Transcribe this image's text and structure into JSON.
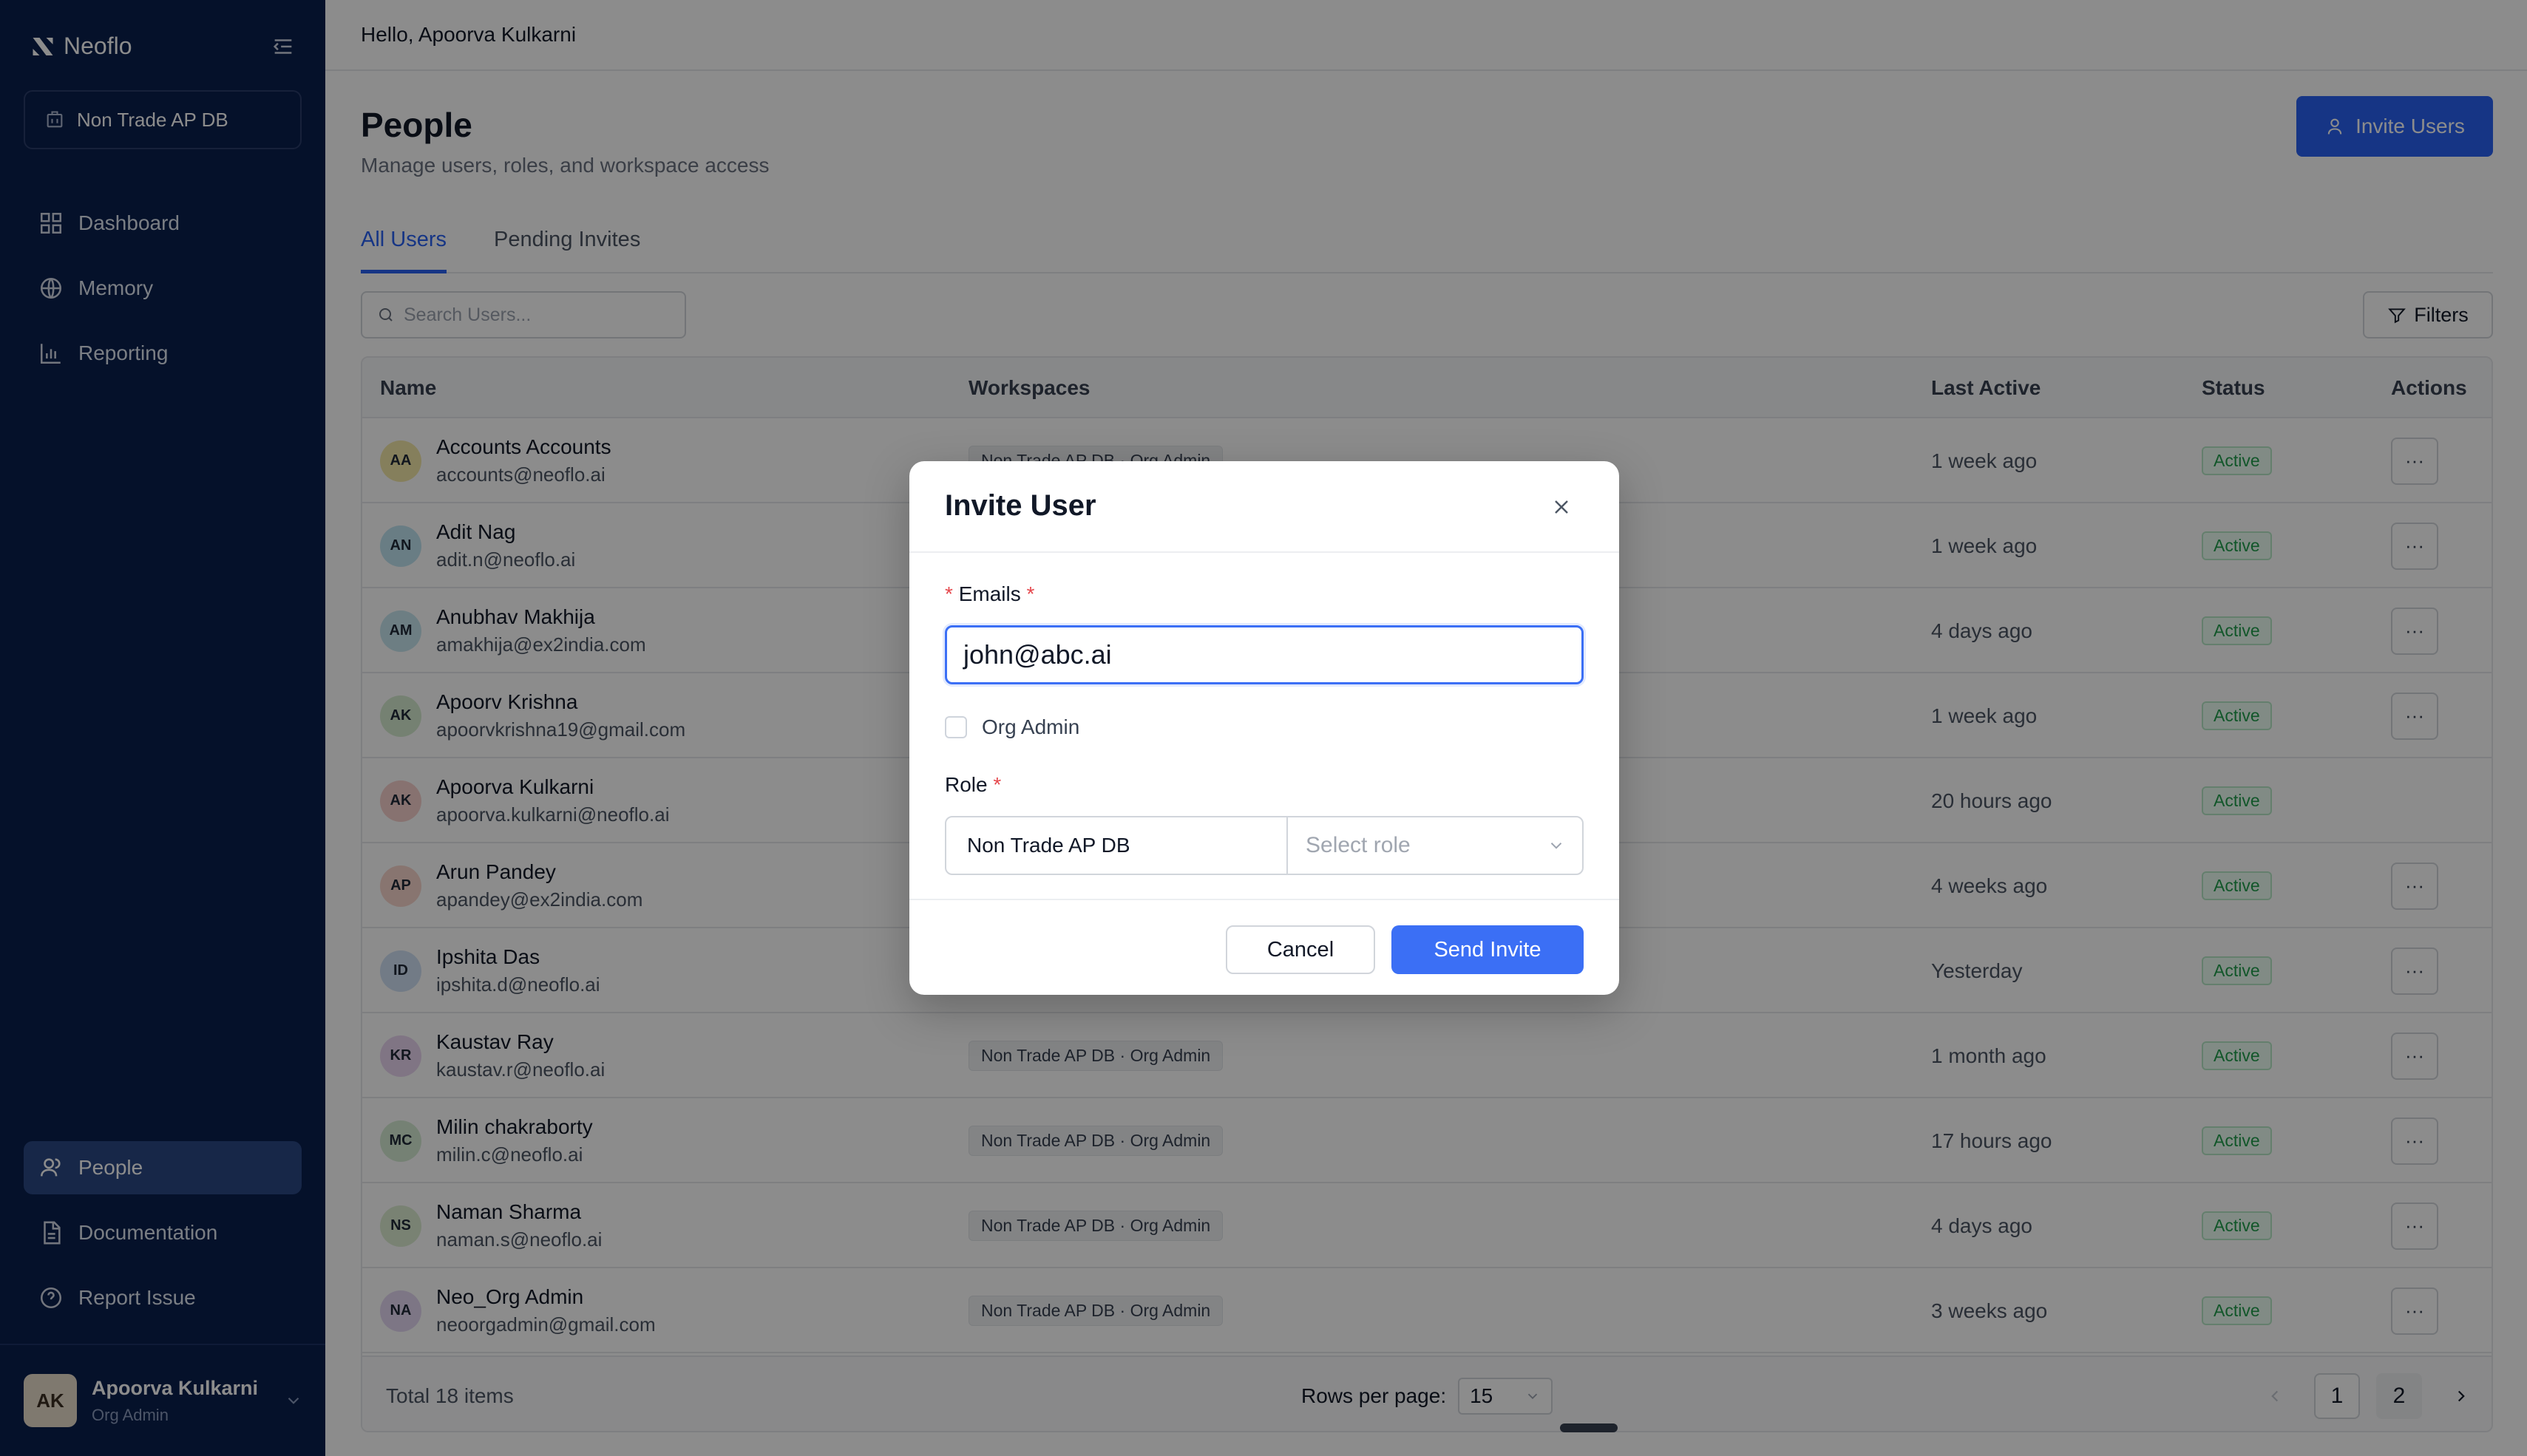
{
  "app": {
    "brand": "Neoflo",
    "greeting": "Hello, Apoorva Kulkarni"
  },
  "sidebar": {
    "workspace": "Non Trade AP DB",
    "top_items": [
      {
        "label": "Dashboard",
        "icon": "dashboard-icon"
      },
      {
        "label": "Memory",
        "icon": "globe-icon"
      },
      {
        "label": "Reporting",
        "icon": "bar-chart-icon"
      }
    ],
    "bottom_items": [
      {
        "label": "People",
        "icon": "users-icon",
        "active": true
      },
      {
        "label": "Documentation",
        "icon": "document-icon"
      },
      {
        "label": "Report Issue",
        "icon": "help-circle-icon"
      }
    ],
    "user": {
      "initials": "AK",
      "name": "Apoorva Kulkarni",
      "role": "Org Admin"
    }
  },
  "page": {
    "title": "People",
    "subtitle": "Manage users, roles, and workspace access",
    "invite_label": "Invite Users",
    "tabs": [
      {
        "label": "All Users",
        "active": true
      },
      {
        "label": "Pending Invites",
        "active": false
      }
    ],
    "search_placeholder": "Search Users...",
    "filters_label": "Filters"
  },
  "table": {
    "headers": [
      "Name",
      "Workspaces",
      "Last Active",
      "Status",
      "Actions"
    ],
    "rows": [
      {
        "initials": "AA",
        "avatar_color": "#f3e7a8",
        "name": "Accounts Accounts",
        "email": "accounts@neoflo.ai",
        "workspace": "Non Trade AP DB · Org Admin",
        "last_active": "1 week ago",
        "status": "Active",
        "has_action": true
      },
      {
        "initials": "AN",
        "avatar_color": "#bfe3f0",
        "name": "Adit Nag",
        "email": "adit.n@neoflo.ai",
        "workspace": "",
        "last_active": "1 week ago",
        "status": "Active",
        "has_action": true
      },
      {
        "initials": "AM",
        "avatar_color": "#c7e6ef",
        "name": "Anubhav Makhija",
        "email": "amakhija@ex2india.com",
        "workspace": "",
        "last_active": "4 days ago",
        "status": "Active",
        "has_action": true
      },
      {
        "initials": "AK",
        "avatar_color": "#d6ebcf",
        "name": "Apoorv Krishna",
        "email": "apoorvkrishna19@gmail.com",
        "workspace": "",
        "last_active": "1 week ago",
        "status": "Active",
        "has_action": true
      },
      {
        "initials": "AK",
        "avatar_color": "#f6cfcc",
        "name": "Apoorva Kulkarni",
        "email": "apoorva.kulkarni@neoflo.ai",
        "workspace": "",
        "last_active": "20 hours ago",
        "status": "Active",
        "has_action": false
      },
      {
        "initials": "AP",
        "avatar_color": "#f8d6cc",
        "name": "Arun Pandey",
        "email": "apandey@ex2india.com",
        "workspace": "",
        "last_active": "4 weeks ago",
        "status": "Active",
        "has_action": true
      },
      {
        "initials": "ID",
        "avatar_color": "#cfe0f5",
        "name": "Ipshita Das",
        "email": "ipshita.d@neoflo.ai",
        "workspace": "",
        "last_active": "Yesterday",
        "status": "Active",
        "has_action": true
      },
      {
        "initials": "KR",
        "avatar_color": "#ead6f1",
        "name": "Kaustav Ray",
        "email": "kaustav.r@neoflo.ai",
        "workspace": "Non Trade AP DB · Org Admin",
        "last_active": "1 month ago",
        "status": "Active",
        "has_action": true
      },
      {
        "initials": "MC",
        "avatar_color": "#d6ecd3",
        "name": "Milin chakraborty",
        "email": "milin.c@neoflo.ai",
        "workspace": "Non Trade AP DB · Org Admin",
        "last_active": "17 hours ago",
        "status": "Active",
        "has_action": true
      },
      {
        "initials": "NS",
        "avatar_color": "#dcedd2",
        "name": "Naman Sharma",
        "email": "naman.s@neoflo.ai",
        "workspace": "Non Trade AP DB · Org Admin",
        "last_active": "4 days ago",
        "status": "Active",
        "has_action": true
      },
      {
        "initials": "NA",
        "avatar_color": "#e3d8f3",
        "name": "Neo_Org Admin",
        "email": "neoorgadmin@gmail.com",
        "workspace": "Non Trade AP DB · Org Admin",
        "last_active": "3 weeks ago",
        "status": "Active",
        "has_action": true
      }
    ],
    "total": "Total 18 items",
    "rows_per_page_label": "Rows per page:",
    "rows_per_page": "15",
    "pages": [
      "1",
      "2"
    ],
    "current_page": "1"
  },
  "modal": {
    "title": "Invite User",
    "emails_label": "Emails",
    "email_value": "john@abc.ai",
    "org_admin_label": "Org Admin",
    "role_label": "Role",
    "role_workspace": "Non Trade AP DB",
    "role_placeholder": "Select role",
    "cancel_label": "Cancel",
    "send_label": "Send Invite"
  },
  "colors": {
    "sidebar_bg": "#0a1f4d",
    "primary": "#2962f2",
    "active_text": "#1f9d4c"
  }
}
